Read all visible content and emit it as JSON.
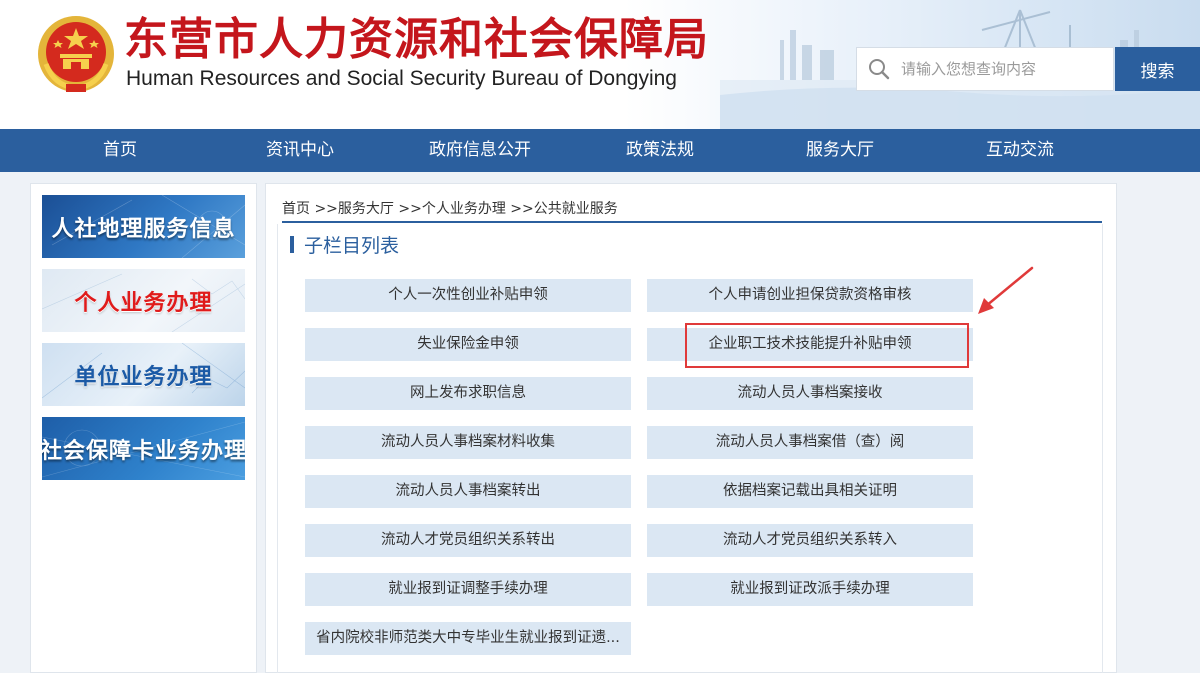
{
  "header": {
    "title_cn": "东营市人力资源和社会保障局",
    "title_en": "Human Resources and Social Security Bureau of Dongying",
    "search": {
      "placeholder": "请输入您想查询内容",
      "button_label": "搜索"
    },
    "emblem_icon": "national-emblem-icon"
  },
  "nav": {
    "items": [
      {
        "label": "首页"
      },
      {
        "label": "资讯中心"
      },
      {
        "label": "政府信息公开"
      },
      {
        "label": "政策法规"
      },
      {
        "label": "服务大厅"
      },
      {
        "label": "互动交流"
      }
    ]
  },
  "sidebar": {
    "banners": [
      {
        "label": "人社地理服务信息"
      },
      {
        "label": "个人业务办理"
      },
      {
        "label": "单位业务办理"
      },
      {
        "label": "社会保障卡业务办理"
      }
    ]
  },
  "main": {
    "breadcrumb": {
      "home": "首页",
      "sep1": " >>",
      "level1": "服务大厅",
      "sep2": " >>",
      "level2": "个人业务办理",
      "sep3": " >>",
      "level3": "公共就业服务"
    },
    "section_title": "子栏目列表",
    "items": [
      {
        "label": "个人一次性创业补贴申领"
      },
      {
        "label": "个人申请创业担保贷款资格审核"
      },
      {
        "label": "失业保险金申领"
      },
      {
        "label": "企业职工技术技能提升补贴申领"
      },
      {
        "label": "网上发布求职信息"
      },
      {
        "label": "流动人员人事档案接收"
      },
      {
        "label": "流动人员人事档案材料收集"
      },
      {
        "label": "流动人员人事档案借（查）阅"
      },
      {
        "label": "流动人员人事档案转出"
      },
      {
        "label": "依据档案记载出具相关证明"
      },
      {
        "label": "流动人才党员组织关系转出"
      },
      {
        "label": "流动人才党员组织关系转入"
      },
      {
        "label": "就业报到证调整手续办理"
      },
      {
        "label": "就业报到证改派手续办理"
      },
      {
        "label": "省内院校非师范类大中专毕业生就业报到证遗..."
      }
    ]
  },
  "annotation": {
    "highlight_color": "#e03a3a"
  },
  "colors": {
    "brand_blue": "#2b5f9e",
    "title_red": "#c4161c",
    "item_bg": "#dbe7f3"
  }
}
